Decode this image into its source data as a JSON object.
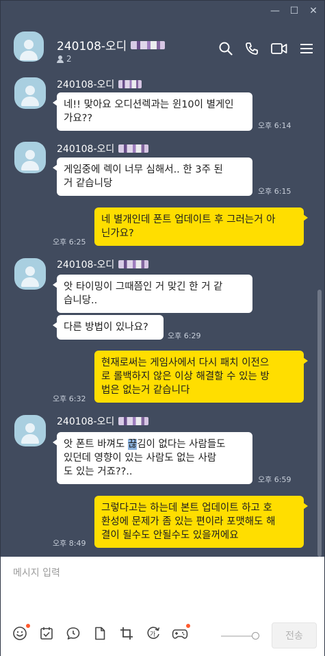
{
  "window": {
    "controls": {
      "minimize": "—",
      "maximize": "☐",
      "close": "✕"
    }
  },
  "header": {
    "room_name": "240108-오디",
    "member_count": "2",
    "actions": [
      "search-icon",
      "call-icon",
      "video-icon",
      "menu-icon"
    ]
  },
  "messages": [
    {
      "sender": "240108-오디",
      "lines": [
        "네!! 맞아요 오디션렉과는 윈10이 별게인",
        "가요??"
      ],
      "time": "오후 6:14",
      "direction": "in"
    },
    {
      "sender": "240108-오디",
      "lines": [
        "게임중에 렉이 너무 심해서.. 한 3주 된",
        "거 같습니당"
      ],
      "time": "오후 6:15",
      "direction": "in"
    },
    {
      "lines": [
        "네 별개인데 폰트 업데이트 후 그러는거 아",
        "닌가요?"
      ],
      "time": "오후 6:25",
      "direction": "out"
    },
    {
      "sender": "240108-오디",
      "lines": [
        "앗 타이밍이 그때쯤인 거 맞긴 한 거 같",
        "습니당.."
      ],
      "time": "",
      "direction": "in"
    },
    {
      "lines": [
        "다른 방법이 있나요?"
      ],
      "time": "오후 6:29",
      "direction": "in"
    },
    {
      "lines": [
        "현재로써는 게임사에서 다시 패치 이전으",
        "로 롤백하지 않은 이상 해결할 수 있는 방",
        "법은 없는거 같습니다"
      ],
      "time": "오후 6:32",
      "direction": "out"
    },
    {
      "sender": "240108-오디",
      "lines_html": [
        "앗 폰트 바껴도 <span class=\"hl\">끊</span>김이 없다는 사람들도",
        " 있던데 영향이 있는 사람도 없는 사람",
        "도 있는 거죠??.."
      ],
      "time": "오후 6:59",
      "direction": "in"
    },
    {
      "lines": [
        "그렇다고는 하는데 본트 업데이트 하고 호",
        "환성에 문제가 좀 있는 편이라 포맷해도 해",
        "결이 될수도 안될수도 있을꺼에요"
      ],
      "time": "오후 8:49",
      "direction": "out"
    }
  ],
  "input": {
    "placeholder": "메시지 입력",
    "send_label": "전송"
  },
  "toolbar": [
    "emoji-icon",
    "checklist-icon",
    "speech-icon",
    "file-icon",
    "crop-icon",
    "translate-icon",
    "game-icon"
  ],
  "colors": {
    "chat_bg": "#414b5e",
    "incoming": "#ffffff",
    "outgoing": "#ffde00",
    "avatar": "#a9cfe0",
    "badge": "#ff5a2e"
  }
}
